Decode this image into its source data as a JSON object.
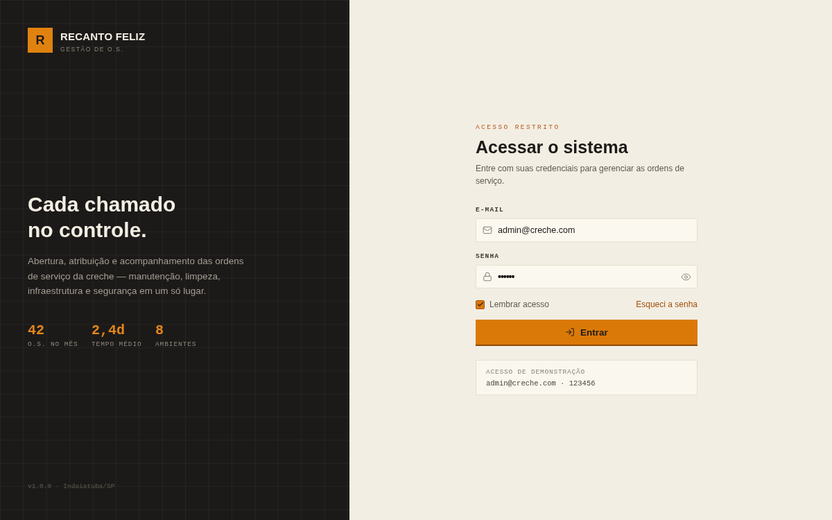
{
  "brand": {
    "logo_letter": "R",
    "name": "RECANTO FELIZ",
    "subtitle": "GESTÃO DE O.S."
  },
  "hero": {
    "title": "Cada chamado no controle.",
    "description": "Abertura, atribuição e acompanhamento das ordens de serviço da creche — manutenção, limpeza, infraestrutura e segurança em um só lugar."
  },
  "stats": [
    {
      "value": "42",
      "label": "O.S. NO MÊS"
    },
    {
      "value": "2,4d",
      "label": "TEMPO MÉDIO"
    },
    {
      "value": "8",
      "label": "AMBIENTES"
    }
  ],
  "footer": "v1.0.0 · Indaiatuba/SP",
  "login": {
    "eyebrow": "ACESSO RESTRITO",
    "title": "Acessar o sistema",
    "subtitle": "Entre com suas credenciais para gerenciar as ordens de serviço.",
    "fields": [
      {
        "kind": "email",
        "label": "E-MAIL",
        "value": "admin@creche.com"
      },
      {
        "kind": "password",
        "label": "SENHA",
        "value": "••••••"
      }
    ],
    "remember": {
      "label": "Lembrar acesso",
      "checked": true
    },
    "forgot_link": "Esqueci a senha",
    "submit_button": "Entrar",
    "demo": {
      "title": "ACESSO DE DEMONSTRAÇÃO",
      "credentials": "admin@creche.com · 123456"
    }
  }
}
